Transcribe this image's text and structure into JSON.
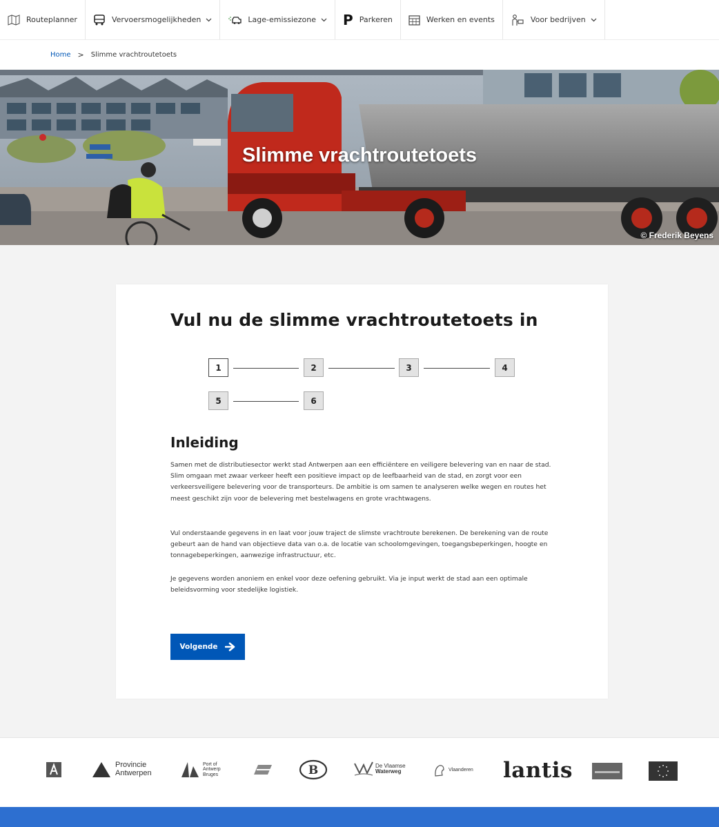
{
  "nav": {
    "items": [
      {
        "label": "Routeplanner",
        "icon": "map-icon",
        "dropdown": false
      },
      {
        "label": "Vervoersmogelijkheden",
        "icon": "bus-icon",
        "dropdown": true
      },
      {
        "label": "Lage-emissiezone",
        "icon": "car-icon",
        "dropdown": true
      },
      {
        "label": "Parkeren",
        "icon": "parking-icon",
        "glyph": "P",
        "dropdown": false
      },
      {
        "label": "Werken en events",
        "icon": "calendar-icon",
        "dropdown": false
      },
      {
        "label": "Voor bedrijven",
        "icon": "business-icon",
        "dropdown": true
      }
    ]
  },
  "breadcrumb": {
    "home": "Home",
    "separator": ">",
    "current": "Slimme vrachtroutetoets"
  },
  "hero": {
    "title": "Slimme vrachtroutetoets",
    "credit": "© Frederik Beyens"
  },
  "card": {
    "title": "Vul nu de slimme vrachtroutetoets in",
    "steps": [
      "1",
      "2",
      "3",
      "4",
      "5",
      "6"
    ],
    "active_step": "1",
    "section_title": "Inleiding",
    "paragraphs": [
      "Samen met de distributiesector werkt stad Antwerpen aan een efficiëntere en veiligere belevering van en naar de stad. Slim omgaan met zwaar verkeer heeft een positieve impact op de leefbaarheid van de stad, en zorgt voor een verkeersveiligere belevering voor de transporteurs. De ambitie is om samen te analyseren welke wegen en routes het meest geschikt zijn voor de belevering met bestelwagens en grote vrachtwagens.",
      "Vul onderstaande gegevens in en laat voor jouw traject de slimste vrachtroute berekenen. De berekening van de route gebeurt aan de hand van objectieve data van o.a. de locatie van schoolomgevingen, toegangsbeperkingen, hoogte en tonnagebeperkingen, aanwezige infrastructuur, etc.",
      "Je gegevens worden anoniem en enkel voor deze oefening gebruikt. Via je input werkt de stad aan een optimale beleidsvorming voor stedelijke logistiek."
    ],
    "next_label": "Volgende"
  },
  "partners": {
    "provincie": [
      "Provincie",
      "Antwerpen"
    ],
    "port": [
      "Port of",
      "Antwerp",
      "Bruges"
    ],
    "waterweg": [
      "De Vlaamse",
      "Waterweg"
    ],
    "vlaanderen": "Vlaanderen",
    "lantis": "lantis"
  },
  "colors": {
    "accent": "#0057b7",
    "footer_bar": "#2d6fd0",
    "background": "#f3f3f3"
  }
}
